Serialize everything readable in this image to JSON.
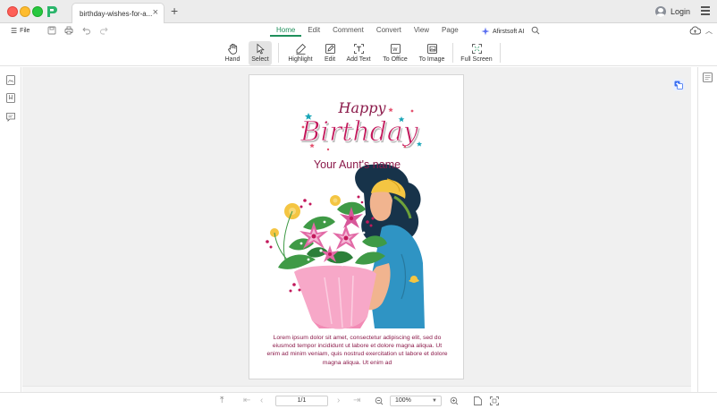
{
  "titlebar": {
    "tab_title": "birthday-wishes-for-a...",
    "tab_close": "×",
    "new_tab": "+",
    "login": "Login"
  },
  "menubar": {
    "file": "File",
    "tabs": [
      {
        "label": "Home",
        "active": true
      },
      {
        "label": "Edit",
        "active": false
      },
      {
        "label": "Comment",
        "active": false
      },
      {
        "label": "Convert",
        "active": false
      },
      {
        "label": "View",
        "active": false
      },
      {
        "label": "Page",
        "active": false
      }
    ],
    "ai": "Afirstsoft AI"
  },
  "toolbar": {
    "tools": [
      {
        "label": "Hand",
        "icon": "hand-icon"
      },
      {
        "label": "Select",
        "icon": "cursor-icon",
        "selected": true
      },
      {
        "label": "Highlight",
        "icon": "highlight-icon"
      },
      {
        "label": "Edit",
        "icon": "edit-icon"
      },
      {
        "label": "Add Text",
        "icon": "add-text-icon"
      },
      {
        "label": "To Office",
        "icon": "to-office-icon"
      },
      {
        "label": "To Image",
        "icon": "to-image-icon"
      },
      {
        "label": "Full Screen",
        "icon": "full-screen-icon"
      }
    ]
  },
  "document": {
    "heading_small": "Happy",
    "heading_large": "Birthday",
    "recipient": "Your Aunt's name",
    "body": "Lorem ipsum dolor sit amet, consectetur adipiscing elit, sed do eiusmod tempor incididunt ut labore et dolore magna aliqua. Ut enim ad minim veniam, quis nostrud exercitation ut labore et dolore magna aliqua. Ut enim ad"
  },
  "statusbar": {
    "page": "1/1",
    "zoom": "100%"
  },
  "colors": {
    "accent": "#1f8f5b",
    "title_magenta": "#8b1a4a",
    "canvas": "#f0f0f0"
  }
}
